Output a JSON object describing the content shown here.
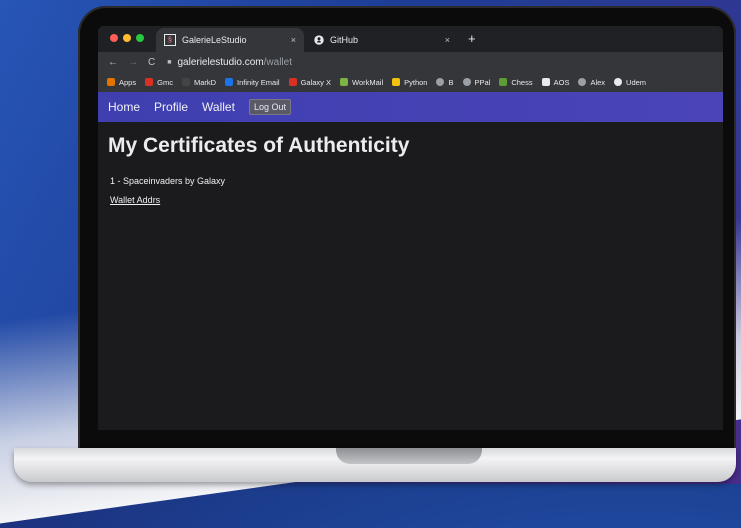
{
  "browser": {
    "tabs": [
      {
        "label": "GalerieLeStudio",
        "icon": "galerie-favicon",
        "close": "×"
      },
      {
        "label": "GitHub",
        "icon": "github-icon",
        "close": "×"
      }
    ],
    "new_tab": "+",
    "url_domain": "galerielestudio.com",
    "url_path": "/wallet",
    "bookmarks": [
      {
        "label": "Apps",
        "color": "#e37400"
      },
      {
        "label": "Gmc",
        "color": "#d93025"
      },
      {
        "label": "MarkD",
        "color": "#444444"
      },
      {
        "label": "Infinity Email",
        "color": "#1a73e8"
      },
      {
        "label": "Galaxy X",
        "color": "#d93025"
      },
      {
        "label": "WorkMail",
        "color": "#7cb342"
      },
      {
        "label": "Python",
        "color": "#f4c20d"
      },
      {
        "label": "B",
        "color": "#9aa0a6"
      },
      {
        "label": "PPal",
        "color": "#9aa0a6"
      },
      {
        "label": "Chess",
        "color": "#5e9c36"
      },
      {
        "label": "AOS",
        "color": "#e8eaed"
      },
      {
        "label": "Alex",
        "color": "#9aa0a6"
      },
      {
        "label": "Udem",
        "color": "#e8eaed"
      }
    ]
  },
  "site": {
    "nav": {
      "home": "Home",
      "profile": "Profile",
      "wallet": "Wallet",
      "logout": "Log Out"
    },
    "title": "My Certificates of Authenticity",
    "certificates": [
      "1 - Spaceinvaders by Galaxy"
    ],
    "wallet_link": "Wallet Addrs"
  }
}
